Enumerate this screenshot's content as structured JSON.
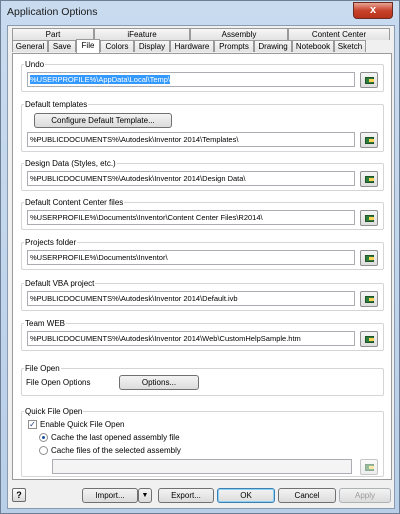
{
  "window": {
    "title": "Application Options",
    "close_glyph": "x"
  },
  "tabs_top": [
    "Part",
    "iFeature",
    "Assembly",
    "Content Center"
  ],
  "tabs_bottom": [
    "General",
    "Save",
    "File",
    "Colors",
    "Display",
    "Hardware",
    "Prompts",
    "Drawing",
    "Notebook",
    "Sketch"
  ],
  "active_tab": "File",
  "sections": {
    "undo": {
      "label": "Undo",
      "path": "%USERPROFILE%\\AppData\\Local\\Temp\\"
    },
    "templates": {
      "label": "Default templates",
      "configure_label": "Configure Default Template...",
      "path": "%PUBLICDOCUMENTS%\\Autodesk\\Inventor 2014\\Templates\\"
    },
    "design_data": {
      "label": "Design Data (Styles, etc.)",
      "path": "%PUBLICDOCUMENTS%\\Autodesk\\Inventor 2014\\Design Data\\"
    },
    "content_center": {
      "label": "Default Content Center files",
      "path": "%USERPROFILE%\\Documents\\Inventor\\Content Center Files\\R2014\\"
    },
    "projects": {
      "label": "Projects folder",
      "path": "%USERPROFILE%\\Documents\\Inventor\\"
    },
    "vba": {
      "label": "Default VBA project",
      "path": "%PUBLICDOCUMENTS%\\Autodesk\\Inventor 2014\\Default.ivb"
    },
    "team_web": {
      "label": "Team WEB",
      "path": "%PUBLICDOCUMENTS%\\Autodesk\\Inventor 2014\\Web\\CustomHelpSample.htm"
    },
    "file_open": {
      "label": "File Open",
      "options_label": "File Open Options",
      "options_button": "Options..."
    },
    "quick_open": {
      "label": "Quick File Open",
      "enable_label": "Enable Quick File Open",
      "enabled": true,
      "radio_last": "Cache the last opened assembly file",
      "radio_selected": "Cache files of the selected assembly",
      "path": ""
    }
  },
  "footer": {
    "help_glyph": "?",
    "import_label": "Import...",
    "export_label": "Export...",
    "ok_label": "OK",
    "cancel_label": "Cancel",
    "apply_label": "Apply"
  },
  "icons": {
    "browse": "folder-browse-icon",
    "help": "help-icon",
    "dropdown": "chevron-down-icon"
  }
}
